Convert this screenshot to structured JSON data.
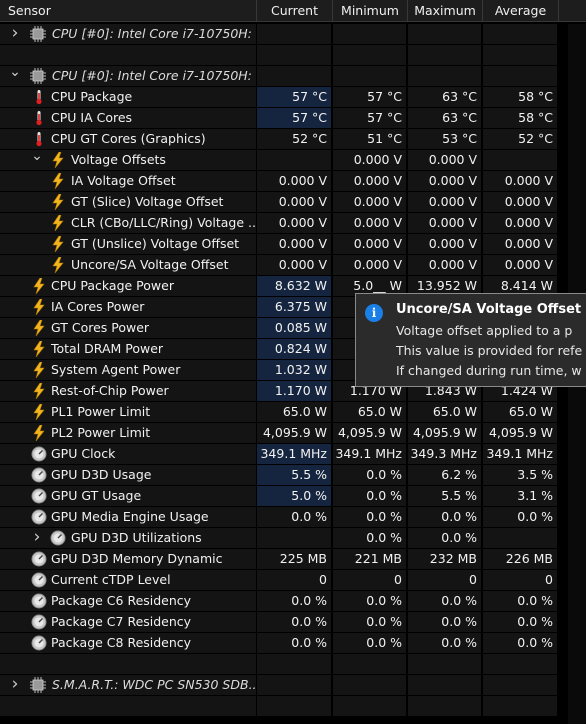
{
  "columns": [
    "Sensor",
    "Current",
    "Minimum",
    "Maximum",
    "Average"
  ],
  "rows": [
    {
      "type": "group",
      "indent": 0,
      "arrow": "right",
      "icon": "chip",
      "label": "CPU [#0]: Intel Core i7-10750H: ..."
    },
    {
      "type": "blank"
    },
    {
      "type": "group",
      "indent": 0,
      "arrow": "down",
      "icon": "chip",
      "label": "CPU [#0]: Intel Core i7-10750H: ..."
    },
    {
      "type": "sensor",
      "indent": 1,
      "icon": "thermometer",
      "label": "CPU Package",
      "current": "57 °C",
      "min": "57 °C",
      "max": "63 °C",
      "avg": "58 °C",
      "hl": true
    },
    {
      "type": "sensor",
      "indent": 1,
      "icon": "thermometer",
      "label": "CPU IA Cores",
      "current": "57 °C",
      "min": "57 °C",
      "max": "63 °C",
      "avg": "58 °C",
      "hl": true
    },
    {
      "type": "sensor",
      "indent": 1,
      "icon": "thermometer",
      "label": "CPU GT Cores (Graphics)",
      "current": "52 °C",
      "min": "51 °C",
      "max": "53 °C",
      "avg": "52 °C",
      "hl": false
    },
    {
      "type": "subgroup",
      "indent": 1,
      "arrow": "down",
      "icon": "bolt",
      "label": "Voltage Offsets",
      "current": "",
      "min": "0.000 V",
      "max": "0.000 V",
      "avg": ""
    },
    {
      "type": "sensor",
      "indent": 2,
      "icon": "bolt",
      "label": "IA Voltage Offset",
      "current": "0.000 V",
      "min": "0.000 V",
      "max": "0.000 V",
      "avg": "0.000 V",
      "hl": false
    },
    {
      "type": "sensor",
      "indent": 2,
      "icon": "bolt",
      "label": "GT (Slice) Voltage Offset",
      "current": "0.000 V",
      "min": "0.000 V",
      "max": "0.000 V",
      "avg": "0.000 V",
      "hl": false
    },
    {
      "type": "sensor",
      "indent": 2,
      "icon": "bolt",
      "label": "CLR (CBo/LLC/Ring) Voltage ...",
      "current": "0.000 V",
      "min": "0.000 V",
      "max": "0.000 V",
      "avg": "0.000 V",
      "hl": false
    },
    {
      "type": "sensor",
      "indent": 2,
      "icon": "bolt",
      "label": "GT (Unslice) Voltage Offset",
      "current": "0.000 V",
      "min": "0.000 V",
      "max": "0.000 V",
      "avg": "0.000 V",
      "hl": false
    },
    {
      "type": "sensor",
      "indent": 2,
      "icon": "bolt",
      "label": "Uncore/SA Voltage Offset",
      "current": "0.000 V",
      "min": "0.000 V",
      "max": "0.000 V",
      "avg": "0.000 V",
      "hl": false
    },
    {
      "type": "sensor",
      "indent": 1,
      "icon": "bolt",
      "label": "CPU Package Power",
      "current": "8.632 W",
      "min": "5.0__ W",
      "max": "13.952 W",
      "avg": "8.414 W",
      "hl": true
    },
    {
      "type": "sensor",
      "indent": 1,
      "icon": "bolt",
      "label": "IA Cores Power",
      "current": "6.375 W",
      "min": "",
      "max": "",
      "avg": "",
      "hl": true
    },
    {
      "type": "sensor",
      "indent": 1,
      "icon": "bolt",
      "label": "GT Cores Power",
      "current": "0.085 W",
      "min": "",
      "max": "",
      "avg": "",
      "hl": true
    },
    {
      "type": "sensor",
      "indent": 1,
      "icon": "bolt",
      "label": "Total DRAM Power",
      "current": "0.824 W",
      "min": "",
      "max": "",
      "avg": "",
      "hl": true
    },
    {
      "type": "sensor",
      "indent": 1,
      "icon": "bolt",
      "label": "System Agent Power",
      "current": "1.032 W",
      "min": "",
      "max": "",
      "avg": "",
      "hl": true
    },
    {
      "type": "sensor",
      "indent": 1,
      "icon": "bolt",
      "label": "Rest-of-Chip Power",
      "current": "1.170 W",
      "min": "1.170 W",
      "max": "1.843 W",
      "avg": "1.424 W",
      "hl": true
    },
    {
      "type": "sensor",
      "indent": 1,
      "icon": "bolt",
      "label": "PL1 Power Limit",
      "current": "65.0 W",
      "min": "65.0 W",
      "max": "65.0 W",
      "avg": "65.0 W",
      "hl": false
    },
    {
      "type": "sensor",
      "indent": 1,
      "icon": "bolt",
      "label": "PL2 Power Limit",
      "current": "4,095.9 W",
      "min": "4,095.9 W",
      "max": "4,095.9 W",
      "avg": "4,095.9 W",
      "hl": false
    },
    {
      "type": "sensor",
      "indent": 1,
      "icon": "gauge",
      "label": "GPU Clock",
      "current": "349.1 MHz",
      "min": "349.1 MHz",
      "max": "349.3 MHz",
      "avg": "349.1 MHz",
      "hl": true
    },
    {
      "type": "sensor",
      "indent": 1,
      "icon": "gauge",
      "label": "GPU D3D Usage",
      "current": "5.5 %",
      "min": "0.0 %",
      "max": "6.2 %",
      "avg": "3.5 %",
      "hl": true
    },
    {
      "type": "sensor",
      "indent": 1,
      "icon": "gauge",
      "label": "GPU GT Usage",
      "current": "5.0 %",
      "min": "0.0 %",
      "max": "5.5 %",
      "avg": "3.1 %",
      "hl": true
    },
    {
      "type": "sensor",
      "indent": 1,
      "icon": "gauge",
      "label": "GPU Media Engine Usage",
      "current": "0.0 %",
      "min": "0.0 %",
      "max": "0.0 %",
      "avg": "0.0 %",
      "hl": false
    },
    {
      "type": "subgroup",
      "indent": 1,
      "arrow": "right",
      "icon": "gauge",
      "label": "GPU D3D Utilizations",
      "current": "",
      "min": "0.0 %",
      "max": "0.0 %",
      "avg": ""
    },
    {
      "type": "sensor",
      "indent": 1,
      "icon": "gauge",
      "label": "GPU D3D Memory Dynamic",
      "current": "225 MB",
      "min": "221 MB",
      "max": "232 MB",
      "avg": "226 MB",
      "hl": false
    },
    {
      "type": "sensor",
      "indent": 1,
      "icon": "gauge",
      "label": "Current cTDP Level",
      "current": "0",
      "min": "0",
      "max": "0",
      "avg": "0",
      "hl": false
    },
    {
      "type": "sensor",
      "indent": 1,
      "icon": "gauge",
      "label": "Package C6 Residency",
      "current": "0.0 %",
      "min": "0.0 %",
      "max": "0.0 %",
      "avg": "0.0 %",
      "hl": false
    },
    {
      "type": "sensor",
      "indent": 1,
      "icon": "gauge",
      "label": "Package C7 Residency",
      "current": "0.0 %",
      "min": "0.0 %",
      "max": "0.0 %",
      "avg": "0.0 %",
      "hl": false
    },
    {
      "type": "sensor",
      "indent": 1,
      "icon": "gauge",
      "label": "Package C8 Residency",
      "current": "0.0 %",
      "min": "0.0 %",
      "max": "0.0 %",
      "avg": "0.0 %",
      "hl": false
    },
    {
      "type": "blank"
    },
    {
      "type": "group",
      "indent": 0,
      "arrow": "right",
      "icon": "chip",
      "label": "S.M.A.R.T.: WDC PC SN530 SDB..."
    },
    {
      "type": "blank"
    }
  ],
  "tooltip": {
    "title": "Uncore/SA Voltage Offset",
    "lines": [
      "Voltage offset applied to a p",
      "This value is provided for refe",
      "If changed during run time, w"
    ]
  },
  "colors": {
    "highlight": "#16253f",
    "cell": "#141414",
    "accent": "#1a7fe6"
  }
}
